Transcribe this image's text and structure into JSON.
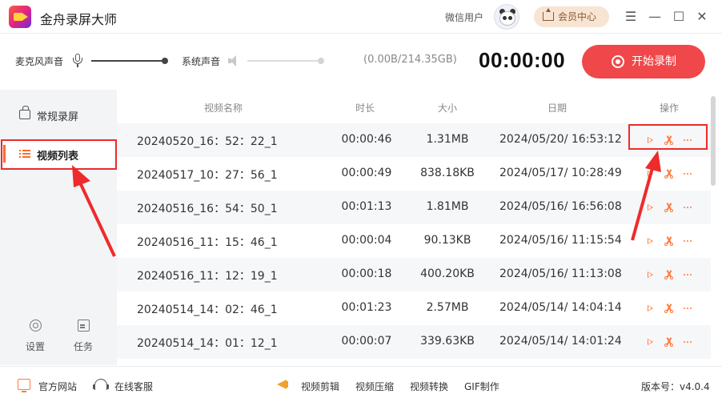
{
  "app": {
    "title": "金舟录屏大师"
  },
  "account": {
    "user_name": "微信用户",
    "vip_label": "会员中心"
  },
  "window_controls": {
    "menu": "☰",
    "minimize": "—",
    "maximize": "☐",
    "close": "✕"
  },
  "toolbar": {
    "mic_label": "麦克风声音",
    "mic_level": 1.0,
    "system_label": "系统声音",
    "system_level": 1.0,
    "storage": "(0.00B/214.35GB)",
    "timer": "00:00:00",
    "record_label": "开始录制"
  },
  "sidebar": {
    "items": [
      {
        "label": "常规录屏",
        "icon": "camera-icon",
        "active": false
      },
      {
        "label": "视频列表",
        "icon": "list-icon",
        "active": true
      }
    ],
    "bottom": [
      {
        "label": "设置",
        "icon": "gear-icon"
      },
      {
        "label": "任务",
        "icon": "clipboard-icon"
      }
    ]
  },
  "table": {
    "headers": {
      "name": "视频名称",
      "duration": "时长",
      "size": "大小",
      "date": "日期",
      "actions": "操作"
    },
    "rows": [
      {
        "name": "20240520_16：52：22_1",
        "duration": "00:00:46",
        "size": "1.31MB",
        "date": "2024/05/20/ 16:53:12"
      },
      {
        "name": "20240517_10：27：56_1",
        "duration": "00:00:49",
        "size": "838.18KB",
        "date": "2024/05/17/ 10:28:49"
      },
      {
        "name": "20240516_16：54：50_1",
        "duration": "00:01:13",
        "size": "1.81MB",
        "date": "2024/05/16/ 16:56:08"
      },
      {
        "name": "20240516_11：15：46_1",
        "duration": "00:00:04",
        "size": "90.13KB",
        "date": "2024/05/16/ 11:15:54"
      },
      {
        "name": "20240516_11：12：19_1",
        "duration": "00:00:18",
        "size": "400.20KB",
        "date": "2024/05/16/ 11:13:08"
      },
      {
        "name": "20240514_14：02：46_1",
        "duration": "00:01:23",
        "size": "2.57MB",
        "date": "2024/05/14/ 14:04:14"
      },
      {
        "name": "20240514_14：01：12_1",
        "duration": "00:00:07",
        "size": "339.63KB",
        "date": "2024/05/14/ 14:01:24"
      }
    ]
  },
  "bottombar": {
    "official_site": "官方网站",
    "support": "在线客服",
    "tools": [
      "视频剪辑",
      "视频压缩",
      "视频转换",
      "GIF制作"
    ],
    "version": "版本号：v4.0.4"
  },
  "colors": {
    "accent": "#ff7a3a",
    "record": "#f0484a",
    "annotation": "#ee2b2b",
    "sidebar_bg": "#f3f4f6"
  }
}
